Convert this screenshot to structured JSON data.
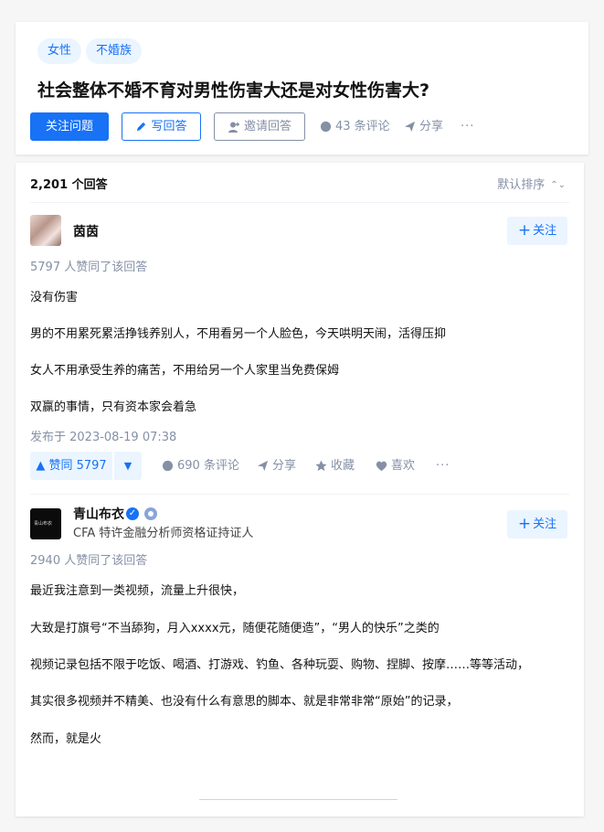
{
  "question": {
    "tags": [
      "女性",
      "不婚族"
    ],
    "title": "社会整体不婚不育对男性伤害大还是对女性伤害大?",
    "actions": {
      "follow_label": "关注问题",
      "write_label": "写回答",
      "invite_label": "邀请回答",
      "comments_label": "43 条评论",
      "share_label": "分享",
      "more_label": "···"
    }
  },
  "answers_header": {
    "count_label": "2,201 个回答",
    "sort_label": "默认排序"
  },
  "answers": [
    {
      "author_name": "茵茵",
      "follow_label": "关注",
      "votes_line": "5797 人赞同了该回答",
      "paragraphs": [
        "没有伤害",
        "男的不用累死累活挣钱养别人，不用看另一个人脸色，今天哄明天闹，活得压抑",
        "女人不用承受生养的痛苦，不用给另一个人家里当免费保姆",
        "双赢的事情，只有资本家会着急"
      ],
      "publish_time": "发布于 2023-08-19 07:38",
      "actions": {
        "upvote_label": "▲ 赞同 5797",
        "downvote_label": "▼",
        "comments_label": "690 条评论",
        "share_label": "分享",
        "collect_label": "收藏",
        "like_label": "喜欢",
        "more_label": "···"
      }
    },
    {
      "author_name": "青山布衣",
      "avatar_text": "青山布衣",
      "headline": "CFA 特许金融分析师资格证持证人",
      "follow_label": "关注",
      "votes_line": "2940 人赞同了该回答",
      "paragraphs": [
        "最近我注意到一类视频，流量上升很快，",
        "大致是打旗号“不当舔狗，月入xxxx元，随便花随便造”，“男人的快乐”之类的",
        "视频记录包括不限于吃饭、喝酒、打游戏、钓鱼、各种玩耍、购物、捏脚、按摩……等等活动，",
        "其实很多视频并不精美、也没有什么有意思的脚本、就是非常非常“原始”的记录，",
        "然而，就是火"
      ]
    }
  ],
  "colors": {
    "accent": "#1772f6",
    "accent_light": "#ebf5ff",
    "muted": "#8590a6"
  }
}
